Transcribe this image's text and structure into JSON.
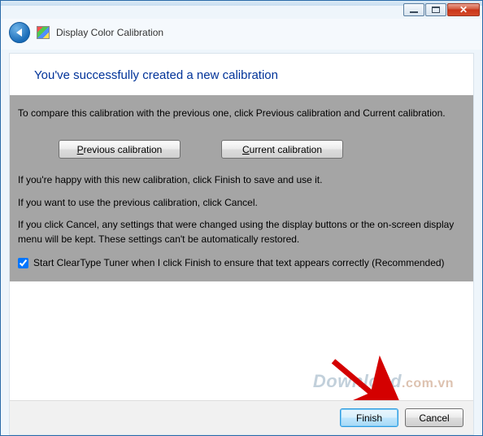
{
  "window": {
    "title": "Display Color Calibration"
  },
  "heading": "You've successfully created a new calibration",
  "body": {
    "compare_instruction": "To compare this calibration with the previous one, click Previous calibration and Current calibration.",
    "previous_btn": "Previous calibration",
    "current_btn": "Current calibration",
    "happy_note": "If you're happy with this new calibration, click Finish to save and use it.",
    "cancel_note": "If you want to use the previous calibration, click Cancel.",
    "cancel_detail": "If you click Cancel, any settings that were changed using the display buttons or the on-screen display menu will be kept. These settings can't be automatically restored.",
    "cleartype_label": "Start ClearType Tuner when I click Finish to ensure that text appears correctly (Recommended)"
  },
  "footer": {
    "finish": "Finish",
    "cancel": "Cancel"
  },
  "watermark": {
    "main": "Download",
    "suffix": ".com.vn"
  }
}
